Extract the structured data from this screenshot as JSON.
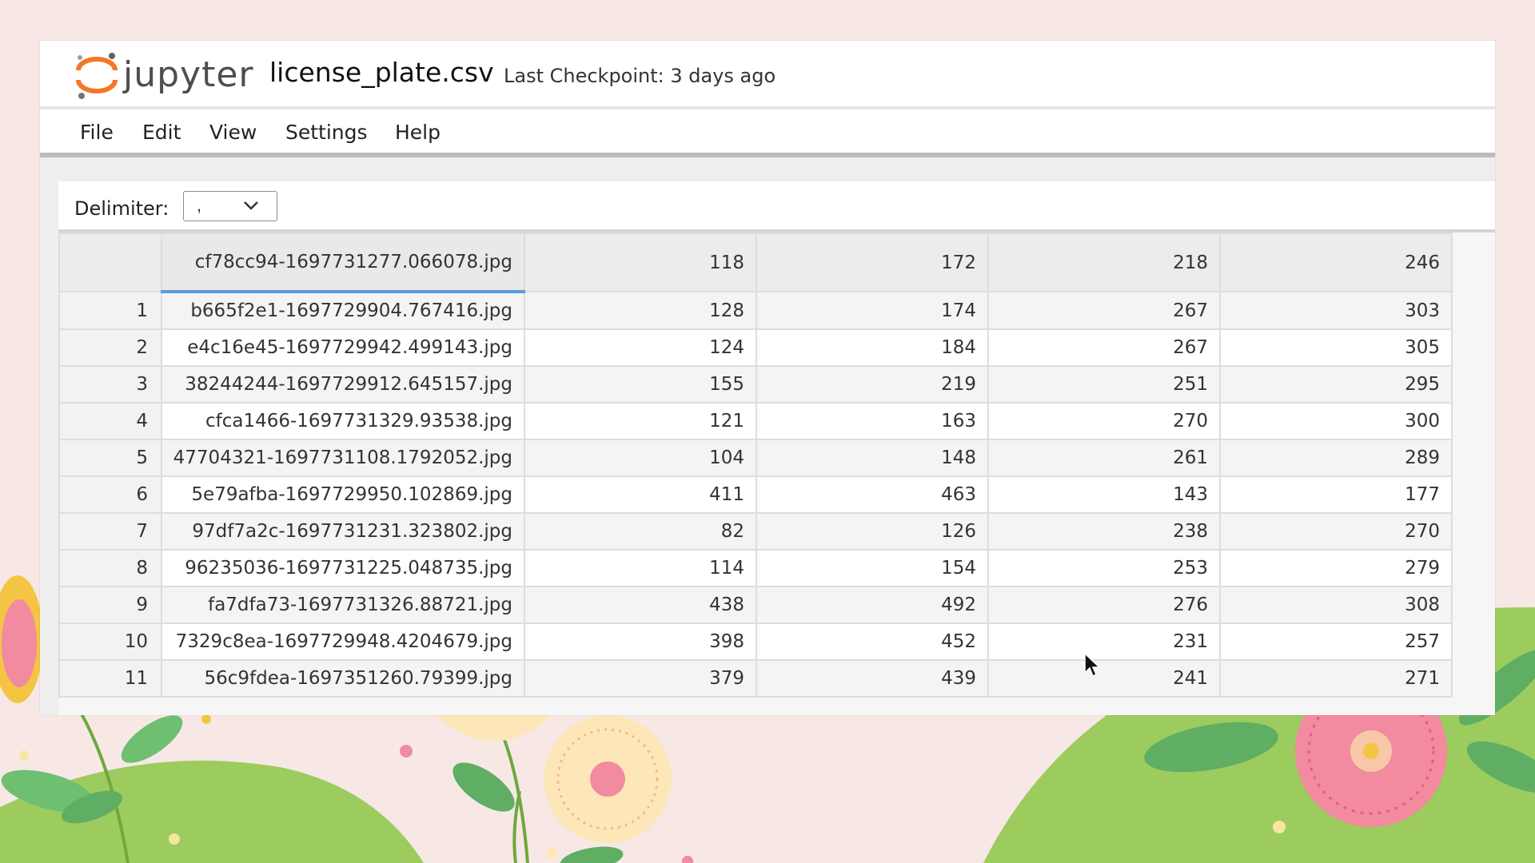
{
  "app": {
    "logo_text": "jupyter",
    "document_name": "license_plate.csv",
    "checkpoint": "Last Checkpoint: 3 days ago"
  },
  "menu": [
    "File",
    "Edit",
    "View",
    "Settings",
    "Help"
  ],
  "toolbar": {
    "delimiter_label": "Delimiter:",
    "delimiter_value": ","
  },
  "grid": {
    "header": [
      "",
      "cf78cc94-1697731277.066078.jpg",
      "118",
      "172",
      "218",
      "246"
    ],
    "rows": [
      [
        "1",
        "b665f2e1-1697729904.767416.jpg",
        "128",
        "174",
        "267",
        "303"
      ],
      [
        "2",
        "e4c16e45-1697729942.499143.jpg",
        "124",
        "184",
        "267",
        "305"
      ],
      [
        "3",
        "38244244-1697729912.645157.jpg",
        "155",
        "219",
        "251",
        "295"
      ],
      [
        "4",
        "cfca1466-1697731329.93538.jpg",
        "121",
        "163",
        "270",
        "300"
      ],
      [
        "5",
        "47704321-1697731108.1792052.jpg",
        "104",
        "148",
        "261",
        "289"
      ],
      [
        "6",
        "5e79afba-1697729950.102869.jpg",
        "411",
        "463",
        "143",
        "177"
      ],
      [
        "7",
        "97df7a2c-1697731231.323802.jpg",
        "82",
        "126",
        "238",
        "270"
      ],
      [
        "8",
        "96235036-1697731225.048735.jpg",
        "114",
        "154",
        "253",
        "279"
      ],
      [
        "9",
        "fa7dfa73-1697731326.88721.jpg",
        "438",
        "492",
        "276",
        "308"
      ],
      [
        "10",
        "7329c8ea-1697729948.4204679.jpg",
        "398",
        "452",
        "231",
        "257"
      ],
      [
        "11",
        "56c9fdea-1697351260.79399.jpg",
        "379",
        "439",
        "241",
        "271"
      ]
    ]
  },
  "colors": {
    "page_background": "#f7e8e6",
    "hill_green": "#9ccb5e",
    "jupyter_orange": "#f37726",
    "selection_blue": "#5d9cd8"
  },
  "icons": {
    "logo": "jupyter-logo-icon",
    "dropdown": "chevron-down-icon",
    "pointer": "mouse-cursor-icon"
  }
}
